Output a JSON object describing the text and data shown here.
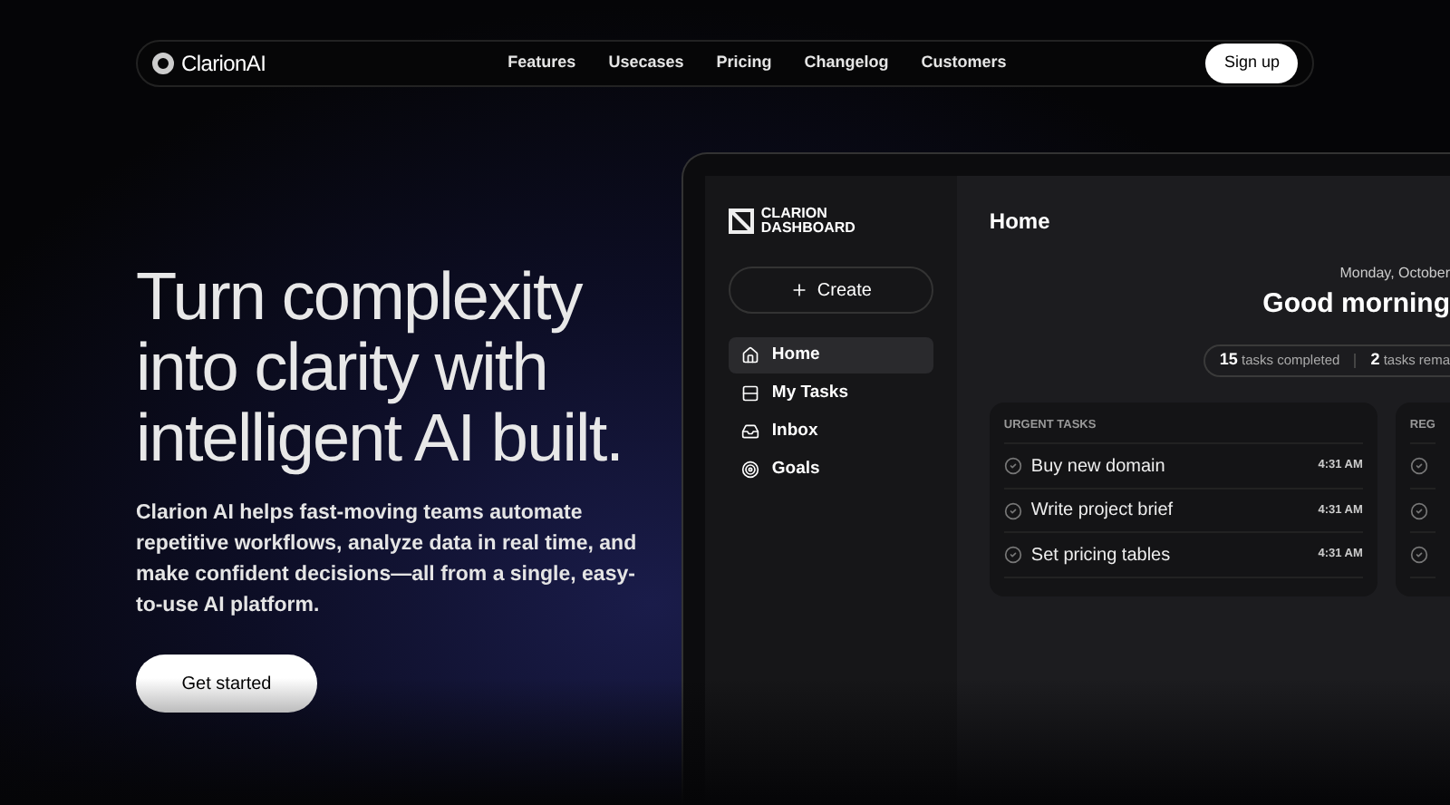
{
  "nav": {
    "brand": "ClarionAI",
    "links": [
      "Features",
      "Usecases",
      "Pricing",
      "Changelog",
      "Customers"
    ],
    "signup": "Sign up"
  },
  "hero": {
    "title_lines": [
      "Turn complexity",
      "into clarity with",
      "intelligent AI built."
    ],
    "description": "Clarion AI helps fast-moving teams automate repetitive workflows, analyze data in real time, and make confident decisions—all from a single, easy-to-use AI platform.",
    "cta": "Get started"
  },
  "dashboard": {
    "logo_lines": [
      "CLARION",
      "DASHBOARD"
    ],
    "create": "Create",
    "sidebar": [
      {
        "label": "Home",
        "selected": true
      },
      {
        "label": "My Tasks",
        "selected": false
      },
      {
        "label": "Inbox",
        "selected": false
      },
      {
        "label": "Goals",
        "selected": false
      }
    ],
    "page_title": "Home",
    "date": "Monday, October",
    "greeting": "Good morning",
    "stats": [
      {
        "count": "15",
        "label": "tasks completed"
      },
      {
        "count": "2",
        "label": "tasks rema"
      }
    ],
    "cards": [
      {
        "title": "URGENT TASKS",
        "tasks": [
          {
            "name": "Buy new domain",
            "time": "4:31 AM"
          },
          {
            "name": "Write project brief",
            "time": "4:31 AM"
          },
          {
            "name": "Set pricing tables",
            "time": "4:31 AM"
          }
        ]
      },
      {
        "title": "REG"
      }
    ]
  }
}
